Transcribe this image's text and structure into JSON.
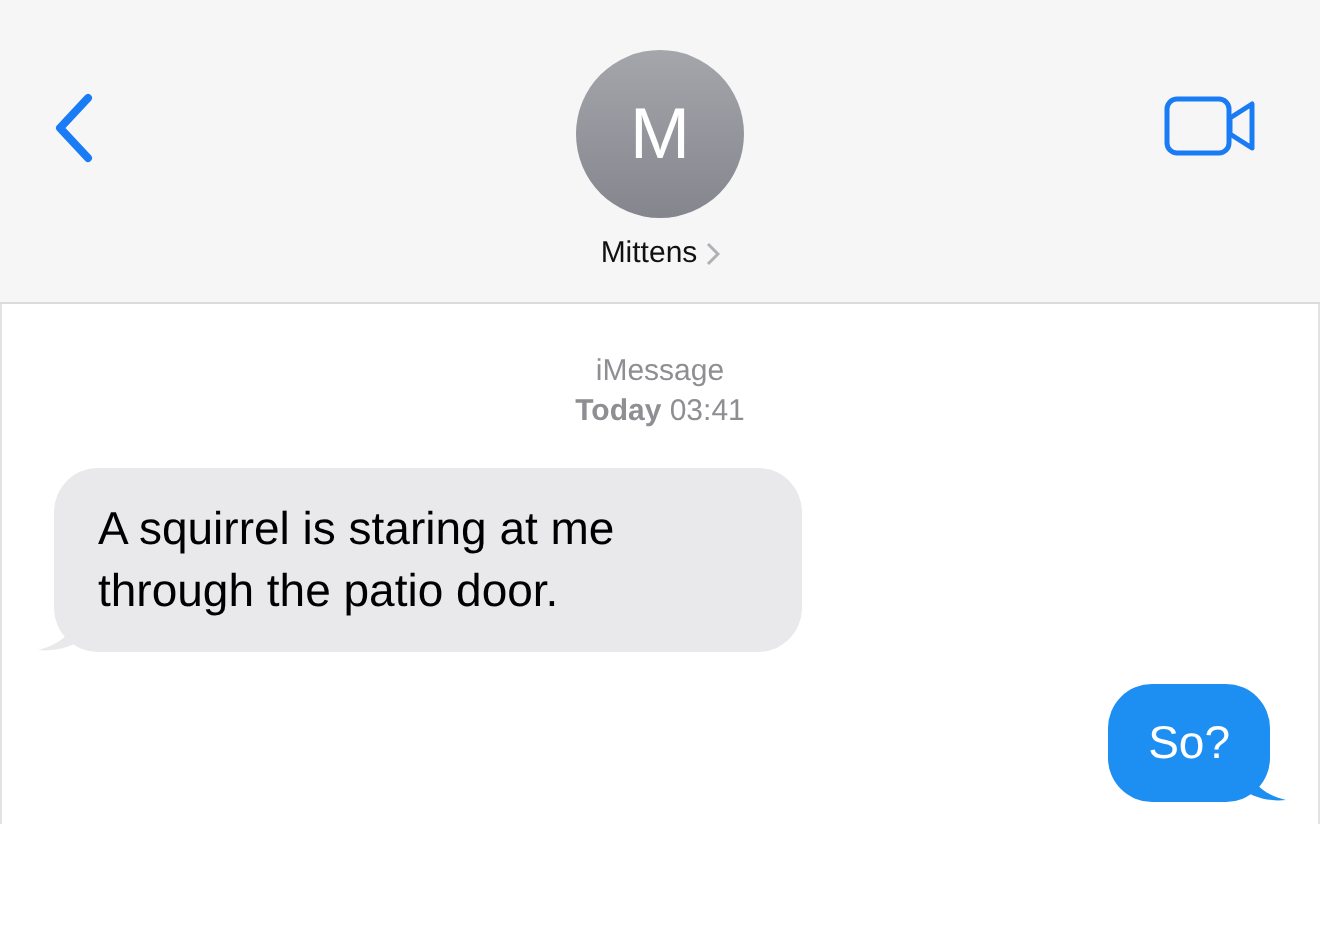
{
  "header": {
    "contact": {
      "initial": "M",
      "name": "Mittens"
    }
  },
  "thread": {
    "service": "iMessage",
    "timestamp": "**Today** 03:41"
  },
  "messages": [
    {
      "kind": "incoming",
      "text": "A squirrel is staring at me through the patio door."
    },
    {
      "kind": "outgoing",
      "text": "So?"
    }
  ]
}
